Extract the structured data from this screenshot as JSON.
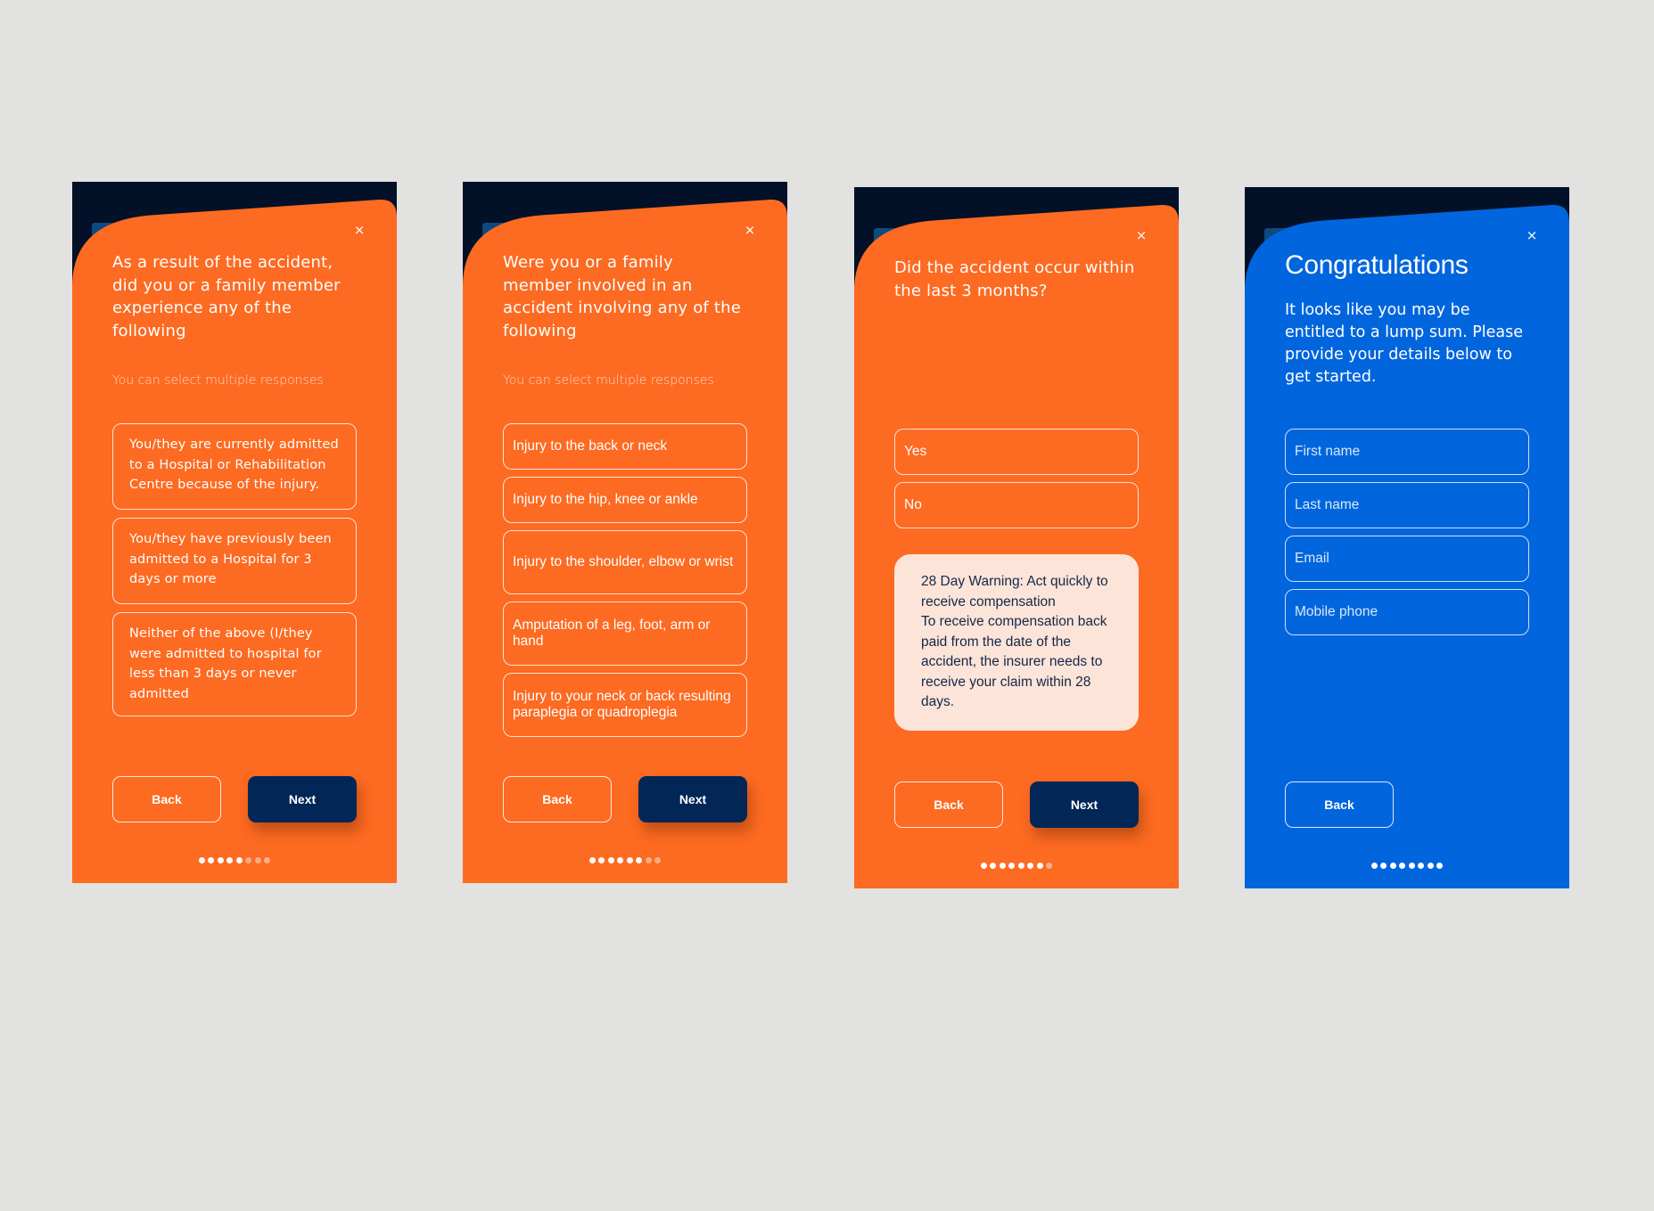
{
  "colors": {
    "orange": "#fd6a21",
    "blue": "#0165dd",
    "navy_button": "#022756",
    "dark_bg": "#021127",
    "warning_bg": "#fde4d8"
  },
  "screens": [
    {
      "close_icon": "×",
      "title": "As a result of the accident, did you or a family member experience any of the following",
      "hint": "You can select multiple responses",
      "options": [
        "You/they are currently admitted to a Hospital or Rehabilitation Centre because of the injury.",
        "You/they have previously been admitted to a Hospital for 3 days or more",
        "Neither of the above (I/they were admitted to hospital for less than 3 days or never admitted"
      ],
      "back_label": "Back",
      "next_label": "Next",
      "progress": {
        "completed": 5,
        "total": 8
      }
    },
    {
      "close_icon": "×",
      "title": "Were you or a family member involved in an accident involving any of the following",
      "hint": "You can select multiple responses",
      "options": [
        "Injury to the back or neck",
        "Injury to the hip, knee or ankle",
        "Injury to the shoulder, elbow or wrist",
        "Amputation of a leg, foot, arm or hand",
        "Injury to your neck or back resulting paraplegia or quadroplegia"
      ],
      "back_label": "Back",
      "next_label": "Next",
      "progress": {
        "completed": 6,
        "total": 8
      }
    },
    {
      "close_icon": "×",
      "title": "Did the accident occur within the last 3 months?",
      "options": [
        "Yes",
        "No"
      ],
      "warning": {
        "heading": "28 Day Warning: Act quickly to receive compensation",
        "body": "To receive compensation back paid from the date of the accident, the insurer needs to receive your claim within 28 days."
      },
      "back_label": "Back",
      "next_label": "Next",
      "progress": {
        "completed": 7,
        "total": 8
      }
    },
    {
      "close_icon": "×",
      "title": "Congratulations",
      "subtitle": "It looks like you may be entitled to a lump sum. Please provide your details below to get started.",
      "fields": [
        {
          "placeholder": "First name",
          "value": ""
        },
        {
          "placeholder": "Last name",
          "value": ""
        },
        {
          "placeholder": "Email",
          "value": ""
        },
        {
          "placeholder": "Mobile phone",
          "value": ""
        }
      ],
      "back_label": "Back",
      "progress": {
        "completed": 8,
        "total": 8
      }
    }
  ]
}
